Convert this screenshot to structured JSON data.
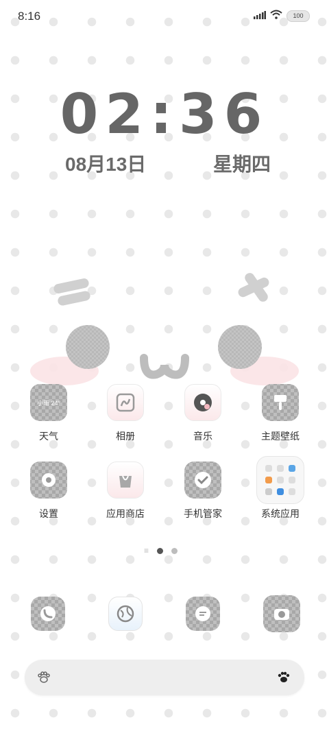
{
  "status_bar": {
    "time": "8:16",
    "battery": "100"
  },
  "clock": {
    "hours": "02",
    "separator": ":",
    "minutes": "36",
    "date": "08月13日",
    "weekday": "星期四"
  },
  "apps": [
    {
      "label": "天气",
      "icon": "weather-icon",
      "icon_text": "小雨 24°"
    },
    {
      "label": "相册",
      "icon": "gallery-icon"
    },
    {
      "label": "音乐",
      "icon": "music-icon"
    },
    {
      "label": "主题壁纸",
      "icon": "theme-brush-icon"
    },
    {
      "label": "设置",
      "icon": "settings-gear-icon"
    },
    {
      "label": "应用商店",
      "icon": "app-store-bag-icon"
    },
    {
      "label": "手机管家",
      "icon": "security-check-icon"
    },
    {
      "label": "系统应用",
      "icon": "system-apps-folder-icon"
    }
  ],
  "page_indicator": {
    "pages": 2,
    "current": 1
  },
  "dock": [
    {
      "icon": "phone-icon"
    },
    {
      "icon": "browser-globe-icon"
    },
    {
      "icon": "messages-icon"
    },
    {
      "icon": "camera-icon"
    }
  ],
  "bottom_bar": {
    "left_icon": "paw-outline-icon",
    "right_icon": "paw-filled-icon"
  },
  "colors": {
    "accent_gray": "#666666",
    "blush_pink": "#fbe3e5"
  }
}
